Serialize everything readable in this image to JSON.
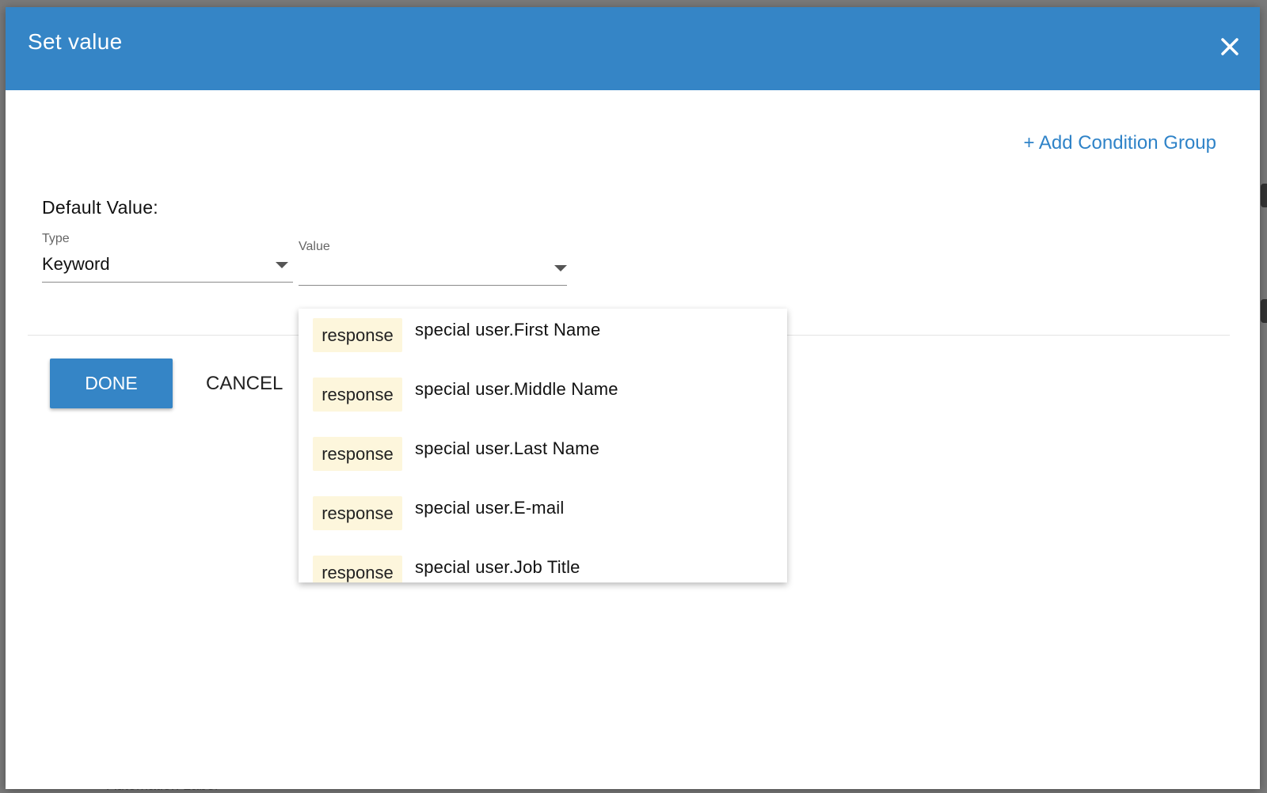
{
  "background": {
    "partial_text": "Automation Label"
  },
  "dialog": {
    "title": "Set value",
    "close_icon": "close-icon",
    "add_condition_group": "+ Add Condition Group",
    "default_value_label": "Default Value:",
    "type_field": {
      "label": "Type",
      "value": "Keyword"
    },
    "value_field": {
      "label": "Value",
      "value": ""
    },
    "done_label": "DONE",
    "cancel_label": "CANCEL"
  },
  "dropdown": {
    "items": [
      {
        "tag": "response",
        "text": "special user.First Name"
      },
      {
        "tag": "response",
        "text": "special user.Middle Name"
      },
      {
        "tag": "response",
        "text": "special user.Last Name"
      },
      {
        "tag": "response",
        "text": "special user.E-mail"
      },
      {
        "tag": "response",
        "text": "special user.Job Title"
      }
    ]
  },
  "colors": {
    "header": "#3585c6",
    "accent": "#2f83c8",
    "tag_bg": "#fdf6dc"
  }
}
